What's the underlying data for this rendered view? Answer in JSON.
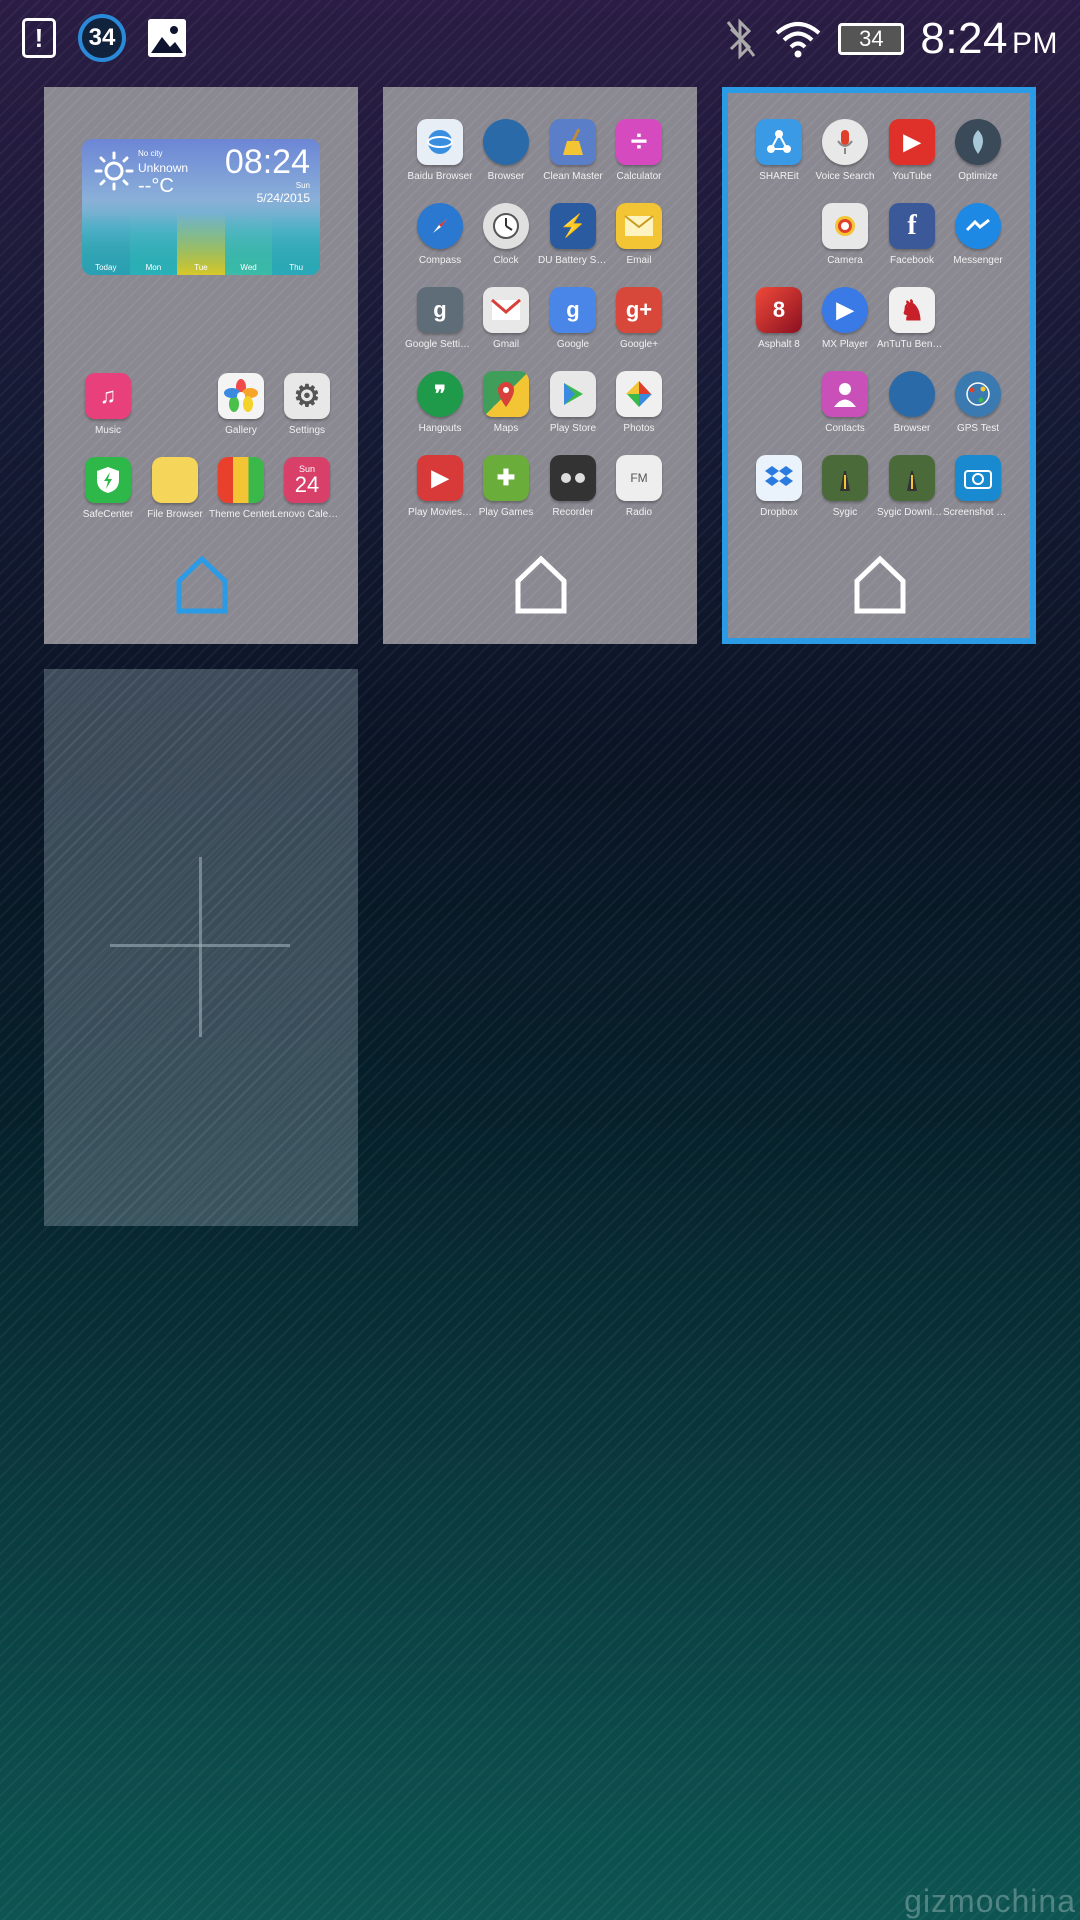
{
  "status_bar": {
    "badge_count": "34",
    "battery_level": "34",
    "time": "8:24",
    "ampm": "PM",
    "icons": [
      "notification-alert-icon",
      "badge-34-icon",
      "gallery-icon",
      "bluetooth-off-icon",
      "wifi-icon",
      "battery-icon"
    ]
  },
  "screen1": {
    "weather": {
      "city": "No city",
      "location": "Unknown",
      "temp": "--°C",
      "time": "08:24",
      "day": "Sun",
      "date": "5/24/2015",
      "days": [
        "Today",
        "Mon",
        "Tue",
        "Wed",
        "Thu"
      ]
    },
    "apps": [
      {
        "label": "Music",
        "icon": "music-icon",
        "color": "#e8407a"
      },
      {
        "label": "Gallery",
        "icon": "gallery-icon",
        "color": "#f4f4f4"
      },
      {
        "label": "Settings",
        "icon": "gear-icon",
        "color": "#e8e8e8"
      },
      {
        "label": "SafeCenter",
        "icon": "shield-icon",
        "color": "#2eb84a"
      },
      {
        "label": "File Browser",
        "icon": "folder-icon",
        "color": "#f5d55a"
      },
      {
        "label": "Theme Center",
        "icon": "theme-icon",
        "color": "#7a3aa0"
      },
      {
        "label": "Lenovo Calen…",
        "icon": "calendar-icon",
        "color": "#d8406a",
        "day": "Sun",
        "num": "24"
      }
    ]
  },
  "screen2": {
    "apps": [
      {
        "label": "Baidu Browser",
        "color": "#3a8ee0"
      },
      {
        "label": "Browser",
        "color": "#2a6aa8"
      },
      {
        "label": "Clean Master",
        "color": "#5a7ec8"
      },
      {
        "label": "Calculator",
        "color": "#d64ac0"
      },
      {
        "label": "Compass",
        "color": "#2a78d0"
      },
      {
        "label": "Clock",
        "color": "#e0e0e0"
      },
      {
        "label": "DU Battery Sa…",
        "color": "#2a5aa0"
      },
      {
        "label": "Email",
        "color": "#f3c433"
      },
      {
        "label": "Google Settin…",
        "color": "#5e6d78"
      },
      {
        "label": "Gmail",
        "color": "#e8e8e8"
      },
      {
        "label": "Google",
        "color": "#4a86e8"
      },
      {
        "label": "Google+",
        "color": "#d8483a"
      },
      {
        "label": "Hangouts",
        "color": "#1f9a4a"
      },
      {
        "label": "Maps",
        "color": "#3f9f5a"
      },
      {
        "label": "Play Store",
        "color": "#e8e8e8"
      },
      {
        "label": "Photos",
        "color": "#f0f0f0"
      },
      {
        "label": "Play Movies…",
        "color": "#d83a3a"
      },
      {
        "label": "Play Games",
        "color": "#6aad3a"
      },
      {
        "label": "Recorder",
        "color": "#333333"
      },
      {
        "label": "Radio",
        "color": "#eeeeee"
      }
    ]
  },
  "screen3": {
    "apps": [
      {
        "label": "SHAREit",
        "color": "#3a9ae6"
      },
      {
        "label": "Voice Search",
        "color": "#e8e8e8"
      },
      {
        "label": "YouTube",
        "color": "#e0302a"
      },
      {
        "label": "Optimize",
        "color": "#3a4a58"
      },
      {
        "label": "Camera",
        "color": "#e8e8e8"
      },
      {
        "label": "Facebook",
        "color": "#3b5998"
      },
      {
        "label": "Messenger",
        "color": "#1e88e5"
      },
      {
        "label": "Asphalt 8",
        "color": "#c8202a"
      },
      {
        "label": "MX Player",
        "color": "#3a7ae6"
      },
      {
        "label": "AnTuTu Benc…",
        "color": "#f0f0f0"
      },
      {
        "label": "Contacts",
        "color": "#c850b8"
      },
      {
        "label": "Browser",
        "color": "#2a6aa8"
      },
      {
        "label": "GPS Test",
        "color": "#3a7ab0"
      },
      {
        "label": "Dropbox",
        "color": "#2a7ae0"
      },
      {
        "label": "Sygic",
        "color": "#4a6a3a"
      },
      {
        "label": "Sygic Download…",
        "color": "#4a6a3a"
      },
      {
        "label": "Screenshot Easy",
        "color": "#1a8ad0"
      }
    ]
  },
  "add_screen": {
    "icon": "plus-icon"
  },
  "watermark": "gizmochina",
  "colors": {
    "accent": "#2b9be6",
    "panel": "#8a8890"
  }
}
